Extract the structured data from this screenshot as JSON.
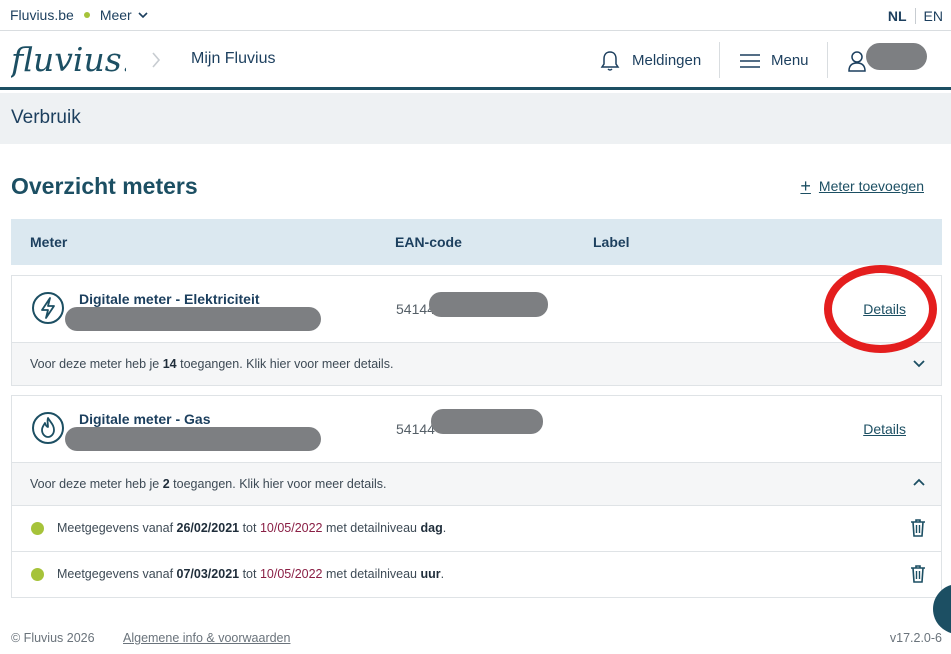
{
  "topbar": {
    "site": "Fluvius.be",
    "more": "Meer",
    "lang_nl": "NL",
    "lang_en": "EN"
  },
  "header": {
    "logo_text": "fluvius.",
    "breadcrumb": "Mijn Fluvius",
    "notifications": "Meldingen",
    "menu": "Menu"
  },
  "subheader": {
    "title": "Verbruik"
  },
  "main": {
    "title": "Overzicht meters",
    "add_meter": "Meter toevoegen",
    "columns": {
      "meter": "Meter",
      "ean": "EAN-code",
      "label": "Label"
    }
  },
  "meters": [
    {
      "name": "Digitale meter - Elektriciteit",
      "ean_prefix": "54144",
      "details": "Details",
      "access_pre": "Voor deze meter heb je ",
      "access_count": "14",
      "access_post": " toegangen. Klik hier voor meer details.",
      "icon": "lightning-icon",
      "expanded": false
    },
    {
      "name": "Digitale meter - Gas",
      "ean_prefix": "54144",
      "details": "Details",
      "access_pre": "Voor deze meter heb je ",
      "access_count": "2",
      "access_post": " toegangen. Klik hier voor meer details.",
      "icon": "flame-icon",
      "expanded": true,
      "grants": [
        {
          "pre": "Meetgegevens vanaf ",
          "from": "26/02/2021",
          "mid": " tot ",
          "to": "10/05/2022",
          "lvl_pre": " met detailniveau ",
          "level": "dag",
          "end": "."
        },
        {
          "pre": "Meetgegevens vanaf ",
          "from": "07/03/2021",
          "mid": " tot ",
          "to": "10/05/2022",
          "lvl_pre": " met detailniveau ",
          "level": "uur",
          "end": "."
        }
      ]
    }
  ],
  "footer": {
    "copyright": "© Fluvius 2026",
    "terms": "Algemene info & voorwaarden",
    "version": "v17.2.0-6"
  },
  "colors": {
    "brand": "#1c4f63",
    "accent_green": "#a6c33a",
    "date_red": "#8a1f45",
    "annotation": "#e41e1e"
  }
}
